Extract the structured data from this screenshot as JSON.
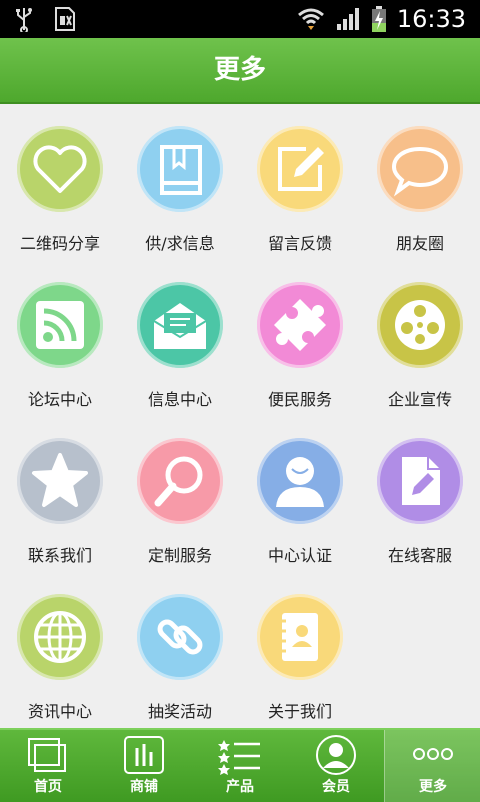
{
  "status_bar": {
    "time": "16:33",
    "usb_icon": "usb-icon",
    "sim_icon": "sim-icon",
    "wifi_icon": "wifi-icon",
    "signal_icon": "signal-icon",
    "battery_icon": "battery-charging-icon"
  },
  "header": {
    "title": "更多"
  },
  "grid": {
    "items": [
      {
        "label": "二维码分享",
        "icon": "heart-icon",
        "color": "#b9d46a"
      },
      {
        "label": "供/求信息",
        "icon": "book-icon",
        "color": "#8fd0f0"
      },
      {
        "label": "留言反馈",
        "icon": "note-pen-icon",
        "color": "#f9d97a"
      },
      {
        "label": "朋友圈",
        "icon": "chat-bubble-icon",
        "color": "#f7bf8a"
      },
      {
        "label": "论坛中心",
        "icon": "rss-icon",
        "color": "#7ed78a"
      },
      {
        "label": "信息中心",
        "icon": "mail-icon",
        "color": "#4cc6a6"
      },
      {
        "label": "便民服务",
        "icon": "puzzle-icon",
        "color": "#f28ad6"
      },
      {
        "label": "企业宣传",
        "icon": "film-reel-icon",
        "color": "#c8c447"
      },
      {
        "label": "联系我们",
        "icon": "star-icon",
        "color": "#b7c0cc"
      },
      {
        "label": "定制服务",
        "icon": "magnifier-icon",
        "color": "#f79aa8"
      },
      {
        "label": "中心认证",
        "icon": "user-icon",
        "color": "#86aee6"
      },
      {
        "label": "在线客服",
        "icon": "document-edit-icon",
        "color": "#b08de6"
      },
      {
        "label": "资讯中心",
        "icon": "globe-icon",
        "color": "#b9d46a"
      },
      {
        "label": "抽奖活动",
        "icon": "link-icon",
        "color": "#8fd0f0"
      },
      {
        "label": "关于我们",
        "icon": "contact-book-icon",
        "color": "#f9d97a"
      }
    ]
  },
  "bottom_nav": {
    "items": [
      {
        "label": "首页",
        "icon": "windows-icon"
      },
      {
        "label": "商铺",
        "icon": "store-chart-icon"
      },
      {
        "label": "产品",
        "icon": "star-list-icon"
      },
      {
        "label": "会员",
        "icon": "member-icon"
      },
      {
        "label": "更多",
        "icon": "more-dots-icon",
        "active": true
      }
    ]
  }
}
